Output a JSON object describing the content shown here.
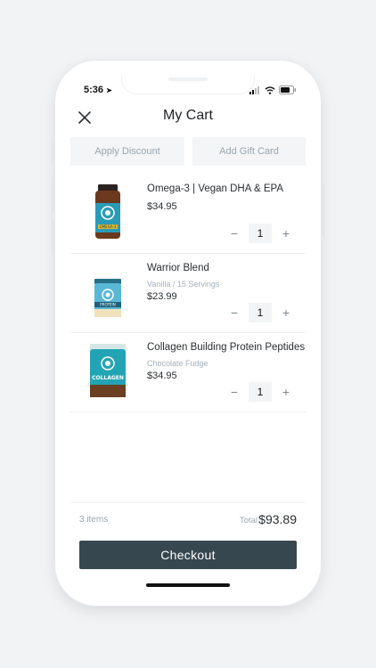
{
  "status": {
    "time": "5:36"
  },
  "header": {
    "title": "My Cart"
  },
  "actions": {
    "discount": "Apply Discount",
    "gift_card": "Add Gift Card"
  },
  "items": [
    {
      "name": "Omega-3 | Vegan DHA & EPA",
      "variant": "",
      "price": "$34.95",
      "qty": "1",
      "product_label": "OMEGA-3"
    },
    {
      "name": "Warrior Blend",
      "variant": "Vanilla / 15 Servings",
      "price": "$23.99",
      "qty": "1",
      "product_label": "PROTEIN"
    },
    {
      "name": "Collagen Building Protein Peptides",
      "variant": "Chocolate Fudge",
      "price": "$34.95",
      "qty": "1",
      "product_label": "COLLAGEN"
    }
  ],
  "summary": {
    "count": "3 items",
    "total_label": "Total",
    "total_value": "$93.89"
  },
  "checkout": {
    "label": "Checkout"
  },
  "colors": {
    "accent": "#37474f",
    "muted": "#97a6b3"
  }
}
